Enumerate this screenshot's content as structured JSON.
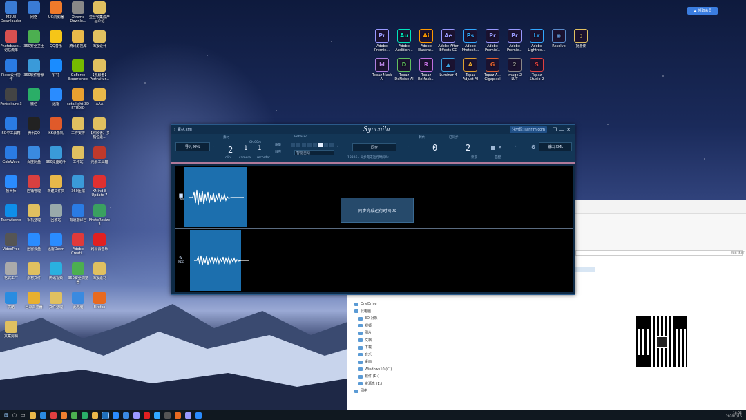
{
  "desktop": {
    "left_icons": [
      {
        "label": "M3U8 Downloader",
        "icon": "download-icon",
        "color": "#3a7bd5"
      },
      {
        "label": "网络",
        "icon": "network-icon",
        "color": "#3a7bd5"
      },
      {
        "label": "UC浏览器",
        "icon": "uc-browser-icon",
        "color": "#f07a2a"
      },
      {
        "label": "Xtreme Downlo...",
        "icon": "download-arrow-icon",
        "color": "#888"
      },
      {
        "label": "亚丝顿集成产品介绍",
        "icon": "document-icon",
        "color": "#e0c060"
      },
      {
        "label": "Photoback... 记忆流年",
        "icon": "photo-icon",
        "color": "#d85050"
      },
      {
        "label": "360安全卫士",
        "icon": "shield-icon",
        "color": "#4caf50"
      },
      {
        "label": "QQ音乐",
        "icon": "music-icon",
        "color": "#f5c518"
      },
      {
        "label": "腾讯影视库",
        "icon": "folder-icon",
        "color": "#e8b84a"
      },
      {
        "label": "海报设计",
        "icon": "document-icon",
        "color": "#e0c060"
      },
      {
        "label": "Pixso设计协作",
        "icon": "pixso-icon",
        "color": "#2a7be4"
      },
      {
        "label": "360软件管家",
        "icon": "store-icon",
        "color": "#3a9ad9"
      },
      {
        "label": "钉钉",
        "icon": "dingtalk-icon",
        "color": "#1a8cff"
      },
      {
        "label": "GeForce Experience",
        "icon": "nvidia-icon",
        "color": "#76b900"
      },
      {
        "label": "【照顾者】Portraitur...",
        "icon": "document-icon",
        "color": "#e0c060"
      },
      {
        "label": "Portraiture 3",
        "icon": "portrait-icon",
        "color": "#444"
      },
      {
        "label": "微信",
        "icon": "wechat-icon",
        "color": "#2aae67"
      },
      {
        "label": "迅雷",
        "icon": "thunder-icon",
        "color": "#2a8cff"
      },
      {
        "label": "seta.light 3D STUDIO",
        "icon": "light-icon",
        "color": "#e8a030"
      },
      {
        "label": "AAA",
        "icon": "folder-icon",
        "color": "#e8b84a"
      },
      {
        "label": "SQ中工具箱",
        "icon": "toolbox-icon",
        "color": "#2a7be4"
      },
      {
        "label": "腾讯QQ",
        "icon": "qq-icon",
        "color": "#222"
      },
      {
        "label": "KK录像机",
        "icon": "camera-icon",
        "color": "#e05a2a"
      },
      {
        "label": "工作安排",
        "icon": "document-icon",
        "color": "#e0c060"
      },
      {
        "label": "【照顾者】多机位素...",
        "icon": "document-icon",
        "color": "#e0c060"
      },
      {
        "label": "GoldWave",
        "icon": "wave-icon",
        "color": "#2a7be4"
      },
      {
        "label": "百度网盘",
        "icon": "cloud-icon",
        "color": "#3a8ae0"
      },
      {
        "label": "360桌面助手",
        "icon": "desktop-icon",
        "color": "#3a9ad9"
      },
      {
        "label": "工作站",
        "icon": "document-icon",
        "color": "#e0c060"
      },
      {
        "label": "元素工具箱",
        "icon": "tool-icon",
        "color": "#c0392b"
      },
      {
        "label": "鲁大师",
        "icon": "master-icon",
        "color": "#2a8cff"
      },
      {
        "label": "店铺管理",
        "icon": "shop-icon",
        "color": "#d84040"
      },
      {
        "label": "新建文件夹",
        "icon": "folder-icon",
        "color": "#e8b84a"
      },
      {
        "label": "360压缩",
        "icon": "zip-icon",
        "color": "#3a9ad9"
      },
      {
        "label": "XMind 8 Update 7",
        "icon": "xmind-icon",
        "color": "#e03030"
      },
      {
        "label": "TeamViewer",
        "icon": "teamviewer-icon",
        "color": "#0e8ee9"
      },
      {
        "label": "相机整理",
        "icon": "document-icon",
        "color": "#e0c060"
      },
      {
        "label": "回收站",
        "icon": "recycle-bin-icon",
        "color": "#9aa"
      },
      {
        "label": "有道翻译官",
        "icon": "translate-icon",
        "color": "#2a7be4"
      },
      {
        "label": "PhotoResize 3",
        "icon": "resize-icon",
        "color": "#3aa060"
      },
      {
        "label": "VideoProc",
        "icon": "film-icon",
        "color": "#555"
      },
      {
        "label": "迅雷云盘",
        "icon": "cloud-icon",
        "color": "#2a8cff"
      },
      {
        "label": "迅雷Down",
        "icon": "download-icon",
        "color": "#2a8cff"
      },
      {
        "label": "Adobe Creati...",
        "icon": "adobe-cc-icon",
        "color": "#e03a3a"
      },
      {
        "label": "网易云音乐",
        "icon": "netease-music-icon",
        "color": "#e02020"
      },
      {
        "label": "格式工厂",
        "icon": "format-factory-icon",
        "color": "#aaa"
      },
      {
        "label": "素材文件",
        "icon": "document-icon",
        "color": "#e0c060"
      },
      {
        "label": "腾讯视频",
        "icon": "play-icon",
        "color": "#2ab0e0"
      },
      {
        "label": "360安全浏览器",
        "icon": "browser-icon",
        "color": "#4caf50"
      },
      {
        "label": "海报素材",
        "icon": "document-icon",
        "color": "#e0c060"
      },
      {
        "label": "优酷",
        "icon": "youku-icon",
        "color": "#2a8ce0"
      },
      {
        "label": "谷歌浏览器",
        "icon": "chrome-icon",
        "color": "#e8b030"
      },
      {
        "label": "文件整理",
        "icon": "document-icon",
        "color": "#e0c060"
      },
      {
        "label": "此电脑",
        "icon": "computer-icon",
        "color": "#3a8ae0"
      },
      {
        "label": "Firefox",
        "icon": "firefox-icon",
        "color": "#e86a20"
      },
      {
        "label": "文案剪辑",
        "icon": "document-icon",
        "color": "#e0c060"
      }
    ],
    "app_icons": [
      {
        "abbr": "Pr",
        "label": "Adobe Premie...",
        "icon": "premiere-icon",
        "color": "#9999ff"
      },
      {
        "abbr": "Au",
        "label": "Adobe Audition...",
        "icon": "audition-icon",
        "color": "#00e4bb"
      },
      {
        "abbr": "Ai",
        "label": "Adobe Illustrat...",
        "icon": "illustrator-icon",
        "color": "#ff9a00"
      },
      {
        "abbr": "Ae",
        "label": "Adobe After Effects CC",
        "icon": "after-effects-icon",
        "color": "#9999ff"
      },
      {
        "abbr": "Ps",
        "label": "Adobe Photosh...",
        "icon": "photoshop-icon",
        "color": "#31a8ff"
      },
      {
        "abbr": "Pr",
        "label": "Adobe Premie...",
        "icon": "premiere-icon",
        "color": "#9999ff"
      },
      {
        "abbr": "Pr",
        "label": "Adobe Premie...",
        "icon": "premiere-icon",
        "color": "#9999ff"
      },
      {
        "abbr": "Lr",
        "label": "Adobe Lightroo...",
        "icon": "lightroom-icon",
        "color": "#31a8ff"
      },
      {
        "abbr": "◉",
        "label": "Resolve",
        "icon": "resolve-icon",
        "color": "#5a8ac8"
      },
      {
        "abbr": "▯",
        "label": "批量传",
        "icon": "document-icon",
        "color": "#e0c060"
      },
      {
        "abbr": "M",
        "label": "Topaz Mask AI",
        "icon": "topaz-mask-icon",
        "color": "#b080e0"
      },
      {
        "abbr": "D",
        "label": "Topaz DeNoise AI",
        "icon": "topaz-denoise-icon",
        "color": "#60c060"
      },
      {
        "abbr": "R",
        "label": "Topaz ReMask...",
        "icon": "topaz-remask-icon",
        "color": "#c070e0"
      },
      {
        "abbr": "▲",
        "label": "Luminar 4",
        "icon": "luminar-icon",
        "color": "#3aa0e0"
      },
      {
        "abbr": "A",
        "label": "Topaz Adjust AI",
        "icon": "topaz-adjust-icon",
        "color": "#e0a030"
      },
      {
        "abbr": "G",
        "label": "Topaz A.I. Gigapixel",
        "icon": "topaz-gigapixel-icon",
        "color": "#e06030"
      },
      {
        "abbr": "2",
        "label": "Image 2 LUT",
        "icon": "image2lut-icon",
        "color": "#888"
      },
      {
        "abbr": "S",
        "label": "Topaz Studio 2",
        "icon": "topaz-studio-icon",
        "color": "#e04040"
      }
    ],
    "cloud_button": "领取会员"
  },
  "app": {
    "title": "素材.xml",
    "logo": "Syncaila",
    "register": "注册码: jianrim.com",
    "close": "✕",
    "minimize": "—",
    "restore": "❐",
    "import_label": "导入 XML",
    "export_label": "输出 XML",
    "sync_label": "同步",
    "col_header_1": "素材",
    "col_header_2": "0h 00m",
    "col_header_3": "Rebased",
    "count_clip": "2",
    "count_camera": "1",
    "count_recorder": "1",
    "lbl_clip": "clip",
    "lbl_camera": "camera",
    "lbl_recorder": "recorder",
    "opt_quality": "质量",
    "opt_order": "顺序",
    "opt_mode": "智能自动",
    "sync_status": "18326 · 同步完成运行时间0s",
    "remain_label": "剩余",
    "synced_label": "已同步",
    "remain_value": "0",
    "synced_value": "2",
    "lbl_read": "读取",
    "lbl_match": "匹配",
    "track1_label": "CAM",
    "track2_label": "REC",
    "overlay_message": "同步完成运行时间0s"
  },
  "explorer": {
    "nav_items": [
      "OneDrive",
      "此电脑",
      "3D 对象",
      "视频",
      "图片",
      "文档",
      "下载",
      "音乐",
      "桌面",
      "Windows10 (C:)",
      "软件 (D:)",
      "资源盘 (E:)",
      "网络"
    ],
    "search_placeholder": "搜索\"素材\""
  },
  "taskbar": {
    "time": "18:52",
    "date": "2020/7/15"
  }
}
